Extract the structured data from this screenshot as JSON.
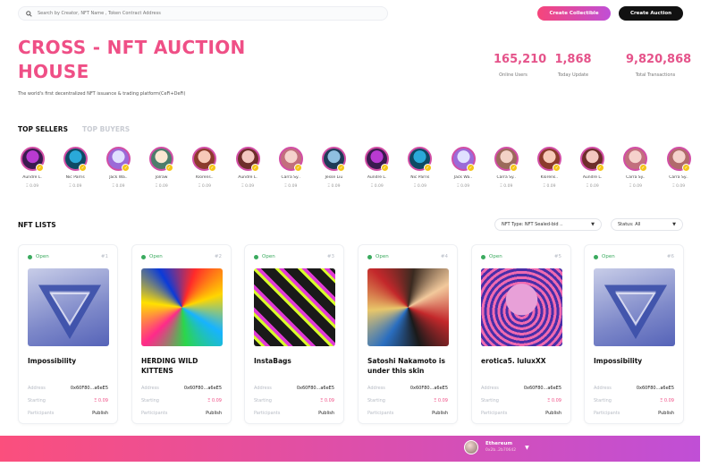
{
  "search": {
    "placeholder": "Search by Creator, NFT Name , Token Contract Address"
  },
  "header": {
    "create_collectible": "Create Collectible",
    "create_auction": "Create Auction"
  },
  "hero": {
    "title": "CROSS - NFT AUCTION HOUSE",
    "subtitle": "The world's first decentralized NFT issuance & trading platform(CeFi+DeFi)"
  },
  "stats": [
    {
      "value": "165,210",
      "label": "Online Users"
    },
    {
      "value": "1,868",
      "label": "Today Update"
    },
    {
      "value": "9,820,868",
      "label": "Total Transactions"
    }
  ],
  "tabs": {
    "top_sellers": "TOP SELLERS",
    "top_buyers": "TOP BUYERS"
  },
  "sellers": [
    {
      "name": "Aundre L.",
      "price": "Ξ 0.09"
    },
    {
      "name": "Nic Parris",
      "price": "Ξ 0.09"
    },
    {
      "name": "Jack Wa..",
      "price": "Ξ 0.09"
    },
    {
      "name": "Jolraw",
      "price": "Ξ 0.09"
    },
    {
      "name": "Klorens..",
      "price": "Ξ 0.09"
    },
    {
      "name": "Aundre L.",
      "price": "Ξ 0.09"
    },
    {
      "name": "Carra Sy..",
      "price": "Ξ 0.09"
    },
    {
      "name": "Jesse Liu",
      "price": "Ξ 0.09"
    },
    {
      "name": "Aundre L.",
      "price": "Ξ 0.09"
    },
    {
      "name": "Nic Parris",
      "price": "Ξ 0.09"
    },
    {
      "name": "Jack Wa..",
      "price": "Ξ 0.09"
    },
    {
      "name": "Carra Sy..",
      "price": "Ξ 0.09"
    },
    {
      "name": "Klorens..",
      "price": "Ξ 0.09"
    },
    {
      "name": "Aundre L.",
      "price": "Ξ 0.09"
    },
    {
      "name": "Carra Sy..",
      "price": "Ξ 0.09"
    },
    {
      "name": "Carra Sy..",
      "price": "Ξ 0.09"
    }
  ],
  "nft_lists": {
    "title": "NFT LISTS",
    "type_filter": "NFT Type: NFT Sealed-bid ..",
    "status_filter": "Status: All"
  },
  "card_labels": {
    "address": "Address",
    "starting": "Starting",
    "participants": "Participants"
  },
  "cards": [
    {
      "status": "Open",
      "num": "#1",
      "title": "Impossibility",
      "address": "0x60F80...a6eE5",
      "starting": "Ξ 0.09",
      "participants": "Publish"
    },
    {
      "status": "Open",
      "num": "#2",
      "title": "HERDING WILD KITTENS",
      "address": "0x60F80...a6eE5",
      "starting": "Ξ 0.09",
      "participants": "Publish"
    },
    {
      "status": "Open",
      "num": "#3",
      "title": "InstaBags",
      "address": "0x60F80...a6eE5",
      "starting": "Ξ 0.09",
      "participants": "Publish"
    },
    {
      "status": "Open",
      "num": "#4",
      "title": "Satoshi Nakamoto is under this skin",
      "address": "0x60F80...a6eE5",
      "starting": "Ξ 0.09",
      "participants": "Publish"
    },
    {
      "status": "Open",
      "num": "#5",
      "title": "erotica5. luluxXX",
      "address": "0x60F80...a6eE5",
      "starting": "Ξ 0.09",
      "participants": "Publish"
    },
    {
      "status": "Open",
      "num": "#6",
      "title": "Impossibility",
      "address": "0x60F80...a6eE5",
      "starting": "Ξ 0.09",
      "participants": "Publish"
    }
  ],
  "wallet": {
    "network": "Ethereum",
    "address": "0x2b..2b70642"
  },
  "colors": {
    "accent": "#ef4f86",
    "gradient_start": "#fb4f7d",
    "gradient_end": "#c04fd6",
    "open_green": "#3aaa5e"
  }
}
